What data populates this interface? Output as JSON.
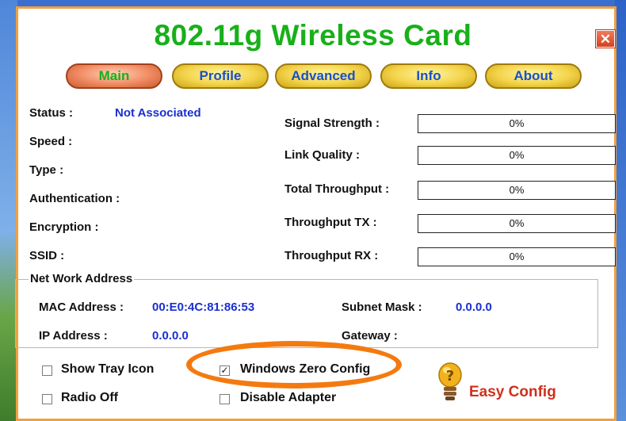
{
  "window": {
    "title": "802.11g Wireless Card",
    "close_label": "✕"
  },
  "tabs": [
    {
      "label": "Main",
      "active": true
    },
    {
      "label": "Profile",
      "active": false
    },
    {
      "label": "Advanced",
      "active": false
    },
    {
      "label": "Info",
      "active": false
    },
    {
      "label": "About",
      "active": false
    }
  ],
  "status": {
    "status_label": "Status :",
    "status_value": "Not Associated",
    "speed_label": "Speed :",
    "type_label": "Type :",
    "auth_label": "Authentication :",
    "enc_label": "Encryption :",
    "ssid_label": "SSID :"
  },
  "meters": [
    {
      "label": "Signal Strength :",
      "value": "0%",
      "percent": 0
    },
    {
      "label": "Link Quality :",
      "value": "0%",
      "percent": 0
    },
    {
      "label": "Total Throughput :",
      "value": "0%",
      "percent": 0
    },
    {
      "label": "Throughput TX :",
      "value": "0%",
      "percent": 0
    },
    {
      "label": "Throughput RX :",
      "value": "0%",
      "percent": 0
    }
  ],
  "network": {
    "group_title": "Net Work Address",
    "mac_label": "MAC Address :",
    "mac_value": "00:E0:4C:81:86:53",
    "subnet_label": "Subnet Mask :",
    "subnet_value": "0.0.0.0",
    "ip_label": "IP Address :",
    "ip_value": "0.0.0.0",
    "gateway_label": "Gateway :",
    "gateway_value": ""
  },
  "options": {
    "show_tray": {
      "label": "Show Tray Icon",
      "checked": false
    },
    "wzc": {
      "label": "Windows Zero Config",
      "checked": true
    },
    "radio_off": {
      "label": "Radio Off",
      "checked": false
    },
    "disable_adapter": {
      "label": "Disable Adapter",
      "checked": false
    }
  },
  "easy_config": {
    "label": "Easy Config",
    "icon": "lightbulb-question-icon"
  },
  "colors": {
    "title": "#18b01a",
    "value_blue": "#1a2fd2",
    "highlight_oval": "#f47a10",
    "easy_config": "#d0301c"
  }
}
